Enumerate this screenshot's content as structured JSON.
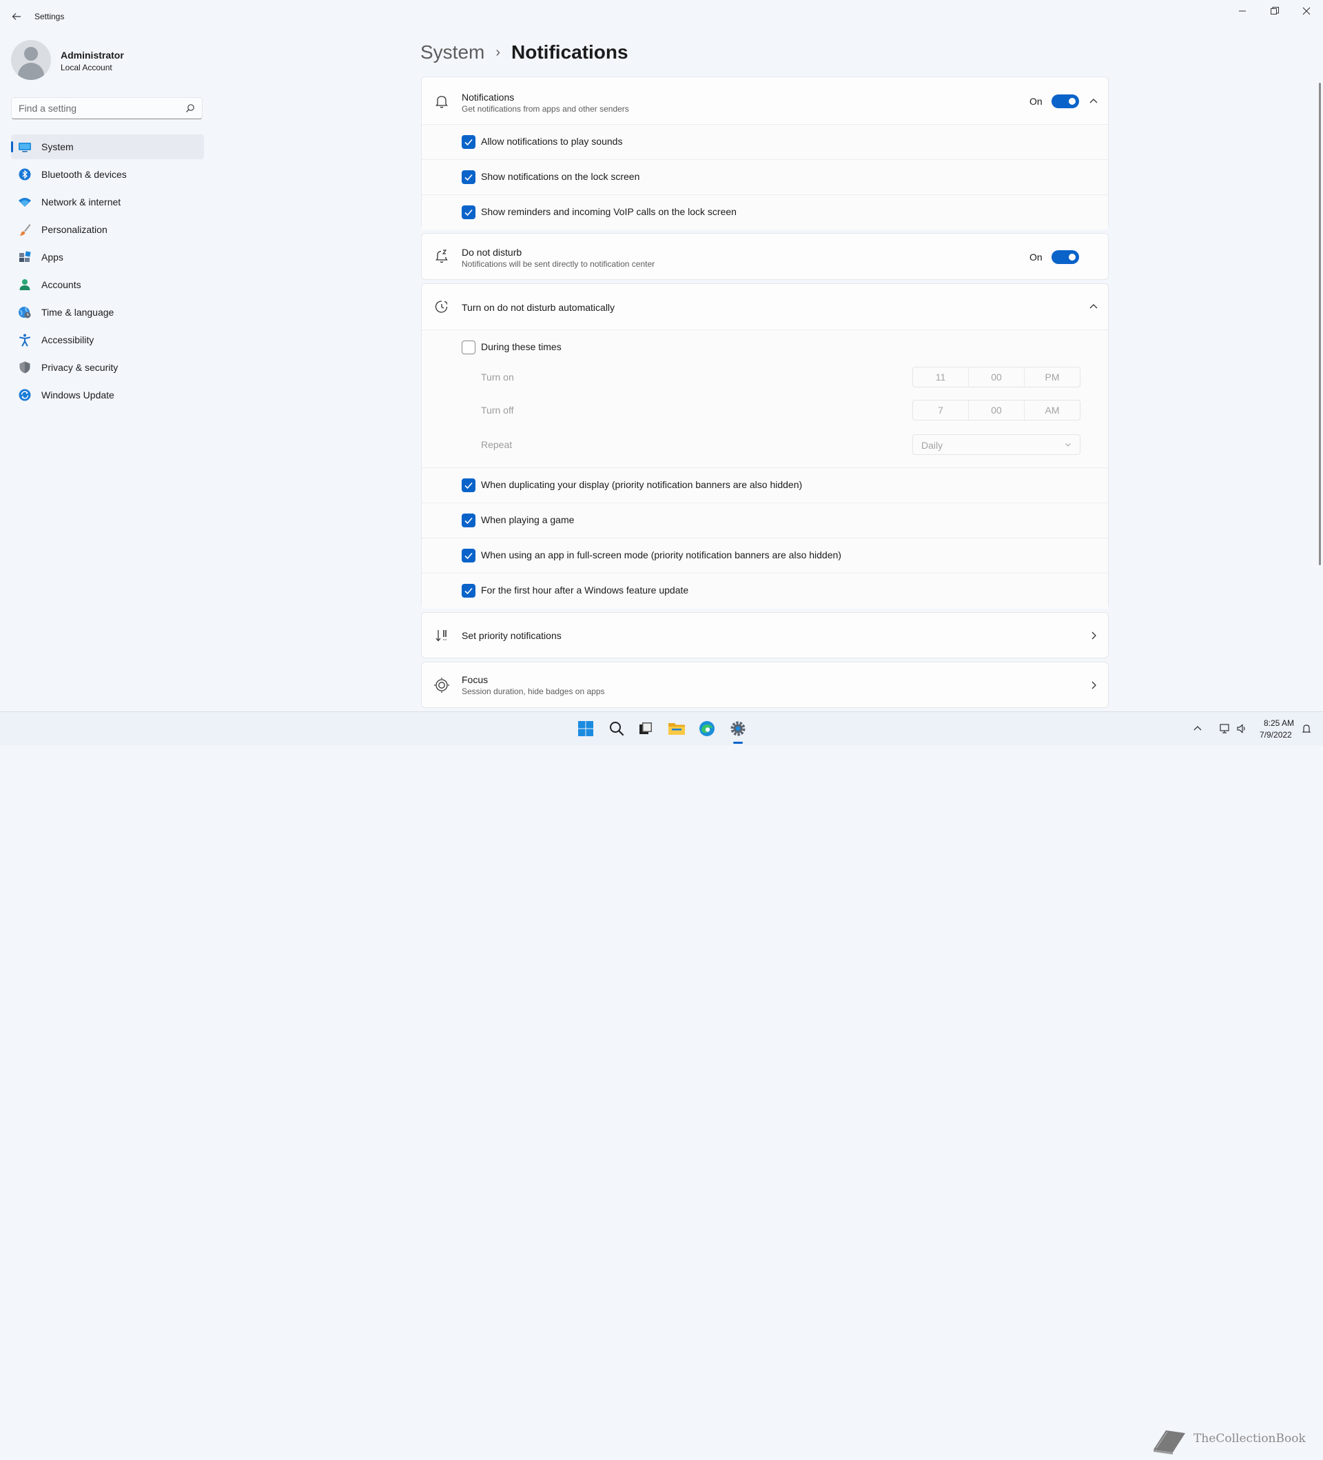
{
  "window": {
    "title": "Settings",
    "back_icon": "back-arrow-icon",
    "minimize_icon": "minimize-icon",
    "maximize_icon": "restore-icon",
    "close_icon": "close-icon"
  },
  "profile": {
    "name": "Administrator",
    "account_type": "Local Account"
  },
  "search": {
    "placeholder": "Find a setting"
  },
  "sidebar": {
    "items": [
      {
        "label": "System",
        "icon": "system-icon",
        "active": true
      },
      {
        "label": "Bluetooth & devices",
        "icon": "bluetooth-icon"
      },
      {
        "label": "Network & internet",
        "icon": "wifi-icon"
      },
      {
        "label": "Personalization",
        "icon": "brush-icon"
      },
      {
        "label": "Apps",
        "icon": "apps-icon"
      },
      {
        "label": "Accounts",
        "icon": "accounts-icon"
      },
      {
        "label": "Time & language",
        "icon": "globe-clock-icon"
      },
      {
        "label": "Accessibility",
        "icon": "accessibility-icon"
      },
      {
        "label": "Privacy & security",
        "icon": "shield-icon"
      },
      {
        "label": "Windows Update",
        "icon": "update-icon"
      }
    ]
  },
  "breadcrumb": {
    "parent": "System",
    "separator": "›",
    "current": "Notifications"
  },
  "notifications": {
    "title": "Notifications",
    "subtitle": "Get notifications from apps and other senders",
    "state": "On",
    "options": [
      {
        "label": "Allow notifications to play sounds",
        "checked": true
      },
      {
        "label": "Show notifications on the lock screen",
        "checked": true
      },
      {
        "label": "Show reminders and incoming VoIP calls on the lock screen",
        "checked": true
      }
    ]
  },
  "dnd": {
    "title": "Do not disturb",
    "subtitle": "Notifications will be sent directly to notification center",
    "state": "On"
  },
  "auto_dnd": {
    "title": "Turn on do not disturb automatically",
    "during_times": {
      "label": "During these times",
      "checked": false
    },
    "turn_on": {
      "label": "Turn on",
      "hour": "11",
      "minute": "00",
      "period": "PM"
    },
    "turn_off": {
      "label": "Turn off",
      "hour": "7",
      "minute": "00",
      "period": "AM"
    },
    "repeat": {
      "label": "Repeat",
      "value": "Daily"
    },
    "conditions": [
      {
        "label": "When duplicating your display (priority notification banners are also hidden)",
        "checked": true
      },
      {
        "label": "When playing a game",
        "checked": true
      },
      {
        "label": "When using an app in full-screen mode (priority notification banners are also hidden)",
        "checked": true
      },
      {
        "label": "For the first hour after a Windows feature update",
        "checked": true
      }
    ]
  },
  "priority": {
    "title": "Set priority notifications"
  },
  "focus": {
    "title": "Focus",
    "subtitle": "Session duration, hide badges on apps"
  },
  "taskbar": {
    "icons": [
      "windows-start-icon",
      "search-icon",
      "task-view-icon",
      "file-explorer-icon",
      "edge-icon",
      "settings-gear-icon"
    ],
    "time": "8:25 AM",
    "date": "7/9/2022",
    "watermark": "TheCollectionBook"
  },
  "colors": {
    "accent": "#0a63c9",
    "background": "#f3f6fb",
    "card": "#fdfdfe"
  }
}
